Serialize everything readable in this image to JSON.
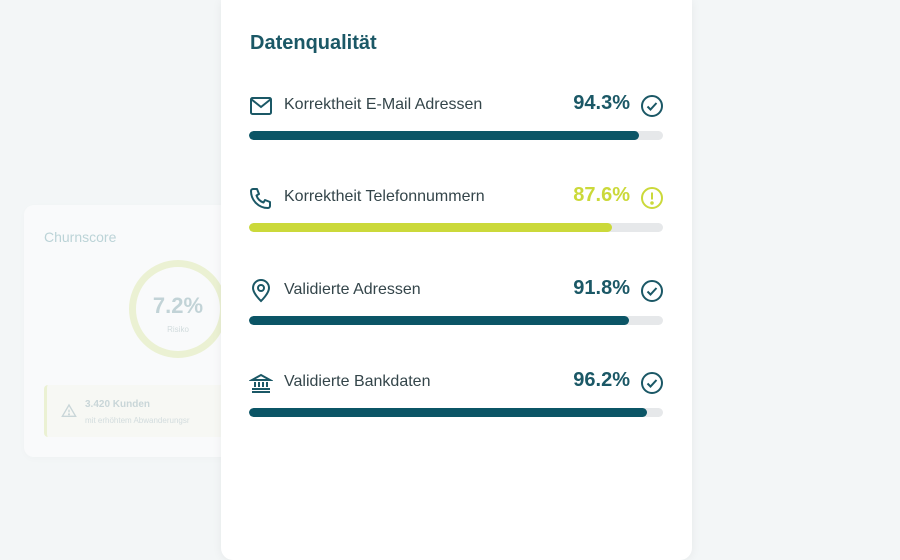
{
  "background_card": {
    "title": "Churnscore",
    "score_value": "7.2%",
    "score_label": "Risiko",
    "alert_title": "3.420 Kunden",
    "alert_text": "mit erhöhtem Abwanderungsr"
  },
  "card": {
    "title": "Datenqualität",
    "metrics": [
      {
        "label": "Korrektheit E-Mail Adressen",
        "value": "94.3%",
        "percent": 94.3,
        "status": "ok",
        "color": "#0b5566",
        "icon": "mail-icon"
      },
      {
        "label": "Korrektheit Telefonnummern",
        "value": "87.6%",
        "percent": 87.6,
        "status": "warning",
        "color": "#cbd93a",
        "icon": "phone-icon"
      },
      {
        "label": "Validierte Adressen",
        "value": "91.8%",
        "percent": 91.8,
        "status": "ok",
        "color": "#0b5566",
        "icon": "location-pin-icon"
      },
      {
        "label": "Validierte Bankdaten",
        "value": "96.2%",
        "percent": 96.2,
        "status": "ok",
        "color": "#0b5566",
        "icon": "bank-icon"
      }
    ]
  }
}
